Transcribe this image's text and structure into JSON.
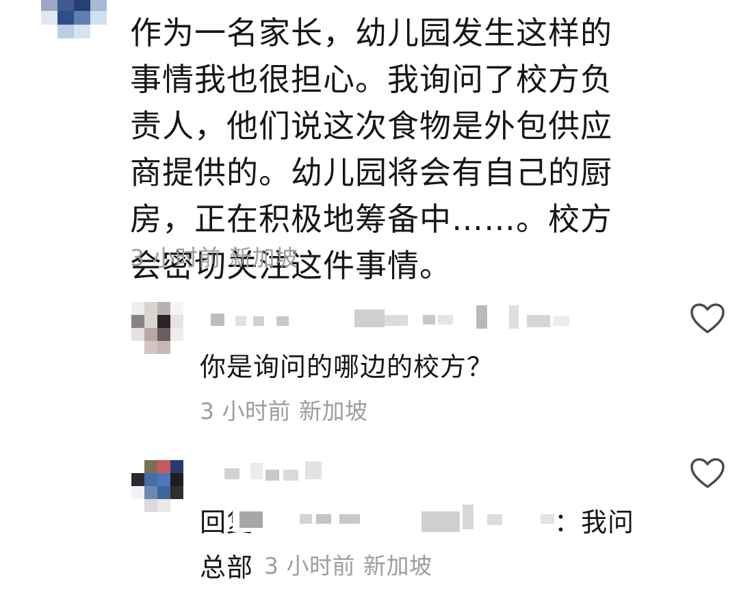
{
  "main_comment": {
    "text": "作为一名家长，幼儿园发生这样的事情我也很担心。我询问了校方负责人，他们说这次食物是外包供应商提供的。幼儿园将会有自己的厨房，正在积极地筹备中……。校方会密切关注这件事情。",
    "time": "3 小时前",
    "location": "新加坡"
  },
  "replies": [
    {
      "text": "你是询问的哪边的校方？",
      "time": "3 小时前",
      "location": "新加坡",
      "like_icon": "heart-icon"
    },
    {
      "prefix": "回复",
      "suffix": "：我问",
      "text_line2": "总部",
      "time": "3 小时前",
      "location": "新加坡",
      "like_icon": "heart-icon"
    }
  ]
}
